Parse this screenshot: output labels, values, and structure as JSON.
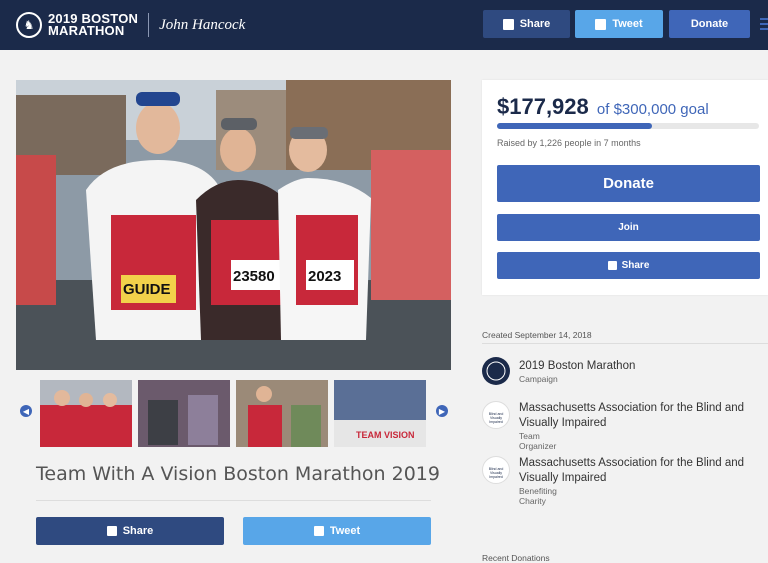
{
  "header": {
    "brand_line1": "2019 BOSTON",
    "brand_line2": "MARATHON",
    "sponsor": "John Hancock",
    "share_label": "Share",
    "tweet_label": "Tweet",
    "donate_label": "Donate"
  },
  "campaign": {
    "title": "Team With A Vision Boston Marathon 2019",
    "share_label": "Share",
    "tweet_label": "Tweet",
    "bibs": [
      "GUIDE",
      "23580",
      "2023"
    ],
    "banner": "TEAM VISION"
  },
  "fundraising": {
    "amount": "$177,928",
    "goal_text": "of $300,000 goal",
    "progress": 0.59,
    "raised_text": "Raised by 1,226 people in 7 months",
    "donate_label": "Donate",
    "join_label": "Join",
    "share_label": "Share"
  },
  "details": {
    "created": "Created September 14, 2018",
    "entities": [
      {
        "name": "2019 Boston Marathon",
        "role": "Campaign"
      },
      {
        "name": "Massachusetts Association for the Blind and Visually Impaired",
        "role": "Team Organizer",
        "logo_text": "Blind and Visually Impaired"
      },
      {
        "name": "Massachusetts Association for the Blind and Visually Impaired",
        "role": "Benefiting Charity",
        "logo_text": "Blind and Visually Impaired"
      }
    ],
    "recent_donations": "Recent Donations"
  },
  "colors": {
    "navy": "#1b2a4a",
    "blue": "#3f66b8",
    "twitter": "#58a6e8",
    "facebook_dark": "#2f4a80"
  }
}
